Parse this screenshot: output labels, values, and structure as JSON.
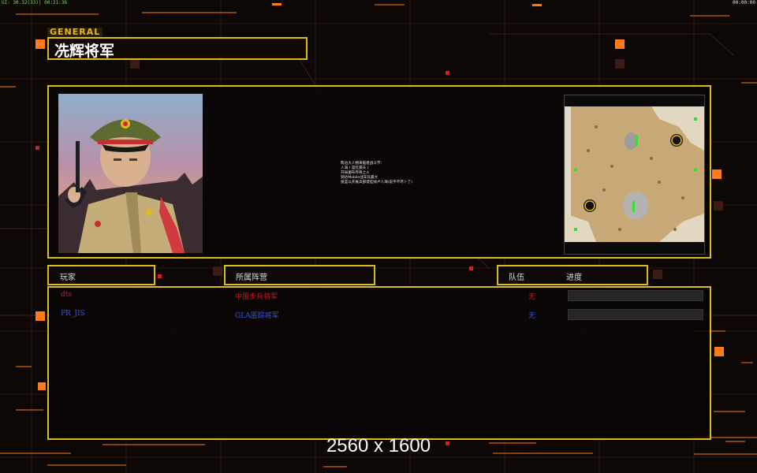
{
  "hud": {
    "top_left": "UI: 30.32(33)| 00:21:36",
    "top_right": "00:00:00"
  },
  "general_label": "GENERAL",
  "general_name": "冼辉将军",
  "description_lines": [
    "陶冶大人物来临者战斗节:",
    "人海  (  是红震天  )",
    "开局遍布传奇之火",
    "到达Mobile战车队最大",
    "投篮以开展兵部谱挂帅卢人海(说不不尽卜了)"
  ],
  "headers": {
    "player": "玩家",
    "faction": "所属阵营",
    "team": "队伍",
    "progress": "进度"
  },
  "players": [
    {
      "name": "dts",
      "faction": "中国步兵将军",
      "team": "无",
      "progress": 0,
      "color": "#c81e1e"
    },
    {
      "name": "PR_JIS",
      "faction": "GLA匿踪将军",
      "team": "无",
      "progress": 0,
      "color": "#3a56d8"
    }
  ],
  "resolution_label": "2560 x 1600",
  "colors": {
    "accent_border": "#d9bc1e",
    "glow_orange": "#ff8a1a",
    "background": "#0d0706"
  }
}
